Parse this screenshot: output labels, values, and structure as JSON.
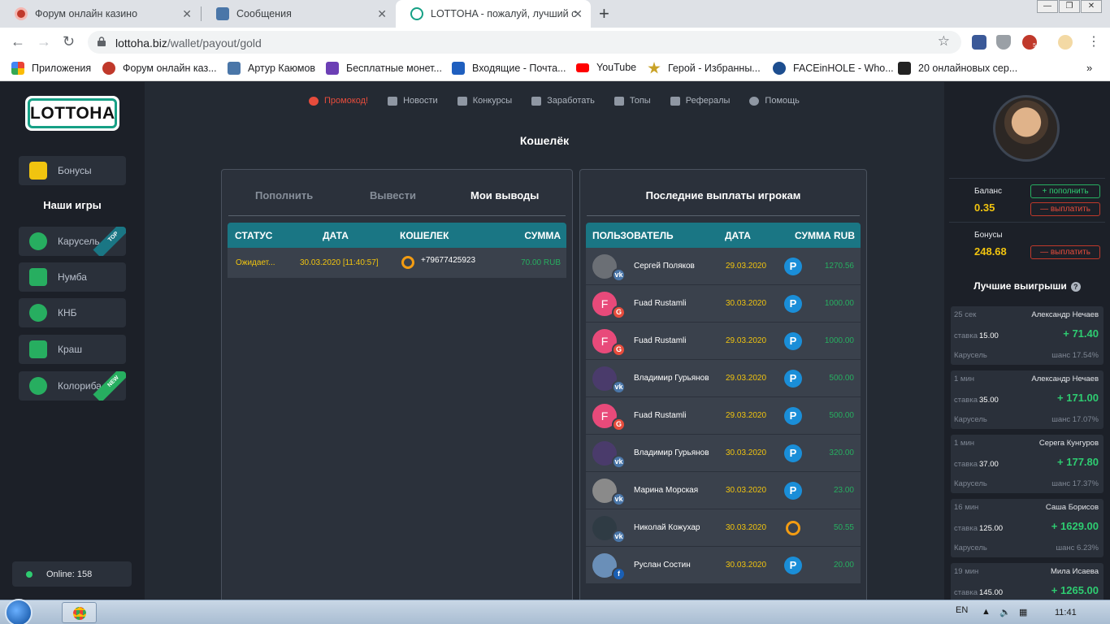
{
  "browser": {
    "tabs": [
      {
        "title": "Форум онлайн казино",
        "active": false
      },
      {
        "title": "Сообщения",
        "active": false
      },
      {
        "title": "LOTTOHA - пожалуй, лучший с",
        "active": true
      }
    ],
    "url_host": "lottoha.biz",
    "url_path": "/wallet/payout/gold",
    "bookmarks": [
      "Приложения",
      "Форум онлайн каз...",
      "Артур Каюмов",
      "Бесплатные монет...",
      "Входящие - Почта...",
      "YouTube",
      "Герой - Избранны...",
      "FACEinHOLE - Who...",
      "20 онлайновых сер..."
    ],
    "ext_badge": "5"
  },
  "site": {
    "logo": "LOTTOHA",
    "bonus_label": "Бонусы",
    "games_header": "Наши игры",
    "games": [
      {
        "label": "Карусель",
        "ribbon": "TOP"
      },
      {
        "label": "Нумба",
        "ribbon": ""
      },
      {
        "label": "КНБ",
        "ribbon": ""
      },
      {
        "label": "Краш",
        "ribbon": ""
      },
      {
        "label": "Колориба",
        "ribbon": "NEW"
      }
    ],
    "online": "Online: 158",
    "nav": [
      "Промокод!",
      "Новости",
      "Конкурсы",
      "Заработать",
      "Топы",
      "Рефералы",
      "Помощь"
    ],
    "page_title": "Кошелёк",
    "wallet": {
      "tabs": [
        "Пополнить",
        "Вывести",
        "Мои выводы"
      ],
      "columns": [
        "СТАТУС",
        "ДАТА",
        "КОШЕЛЕК",
        "СУММА"
      ],
      "rows": [
        {
          "status": "Ожидает...",
          "date": "30.03.2020 [11:40:57]",
          "wallet": "+79677425923",
          "sum": "70.00 RUB"
        }
      ]
    },
    "payouts": {
      "title": "Последние выплаты игрокам",
      "columns": [
        "ПОЛЬЗОВАТЕЛЬ",
        "ДАТА",
        "СУММА RUB"
      ],
      "rows": [
        {
          "name": "Сергей Поляков",
          "date": "29.03.2020",
          "method": "P",
          "sum": "1270.56",
          "social": "vk",
          "avatar": "#6b6f75"
        },
        {
          "name": "Fuad Rustamli",
          "date": "30.03.2020",
          "method": "P",
          "sum": "1000.00",
          "social": "g",
          "avatar": "#e84a7a"
        },
        {
          "name": "Fuad Rustamli",
          "date": "29.03.2020",
          "method": "P",
          "sum": "1000.00",
          "social": "g",
          "avatar": "#e84a7a"
        },
        {
          "name": "Владимир Гурьянов",
          "date": "29.03.2020",
          "method": "P",
          "sum": "500.00",
          "social": "vk",
          "avatar": "#4a3b6b"
        },
        {
          "name": "Fuad Rustamli",
          "date": "29.03.2020",
          "method": "P",
          "sum": "500.00",
          "social": "g",
          "avatar": "#e84a7a"
        },
        {
          "name": "Владимир Гурьянов",
          "date": "30.03.2020",
          "method": "P",
          "sum": "320.00",
          "social": "vk",
          "avatar": "#4a3b6b"
        },
        {
          "name": "Марина Морская",
          "date": "30.03.2020",
          "method": "P",
          "sum": "23.00",
          "social": "vk",
          "avatar": "#8a8a8a"
        },
        {
          "name": "Николай Кожухар",
          "date": "30.03.2020",
          "method": "Q",
          "sum": "50.55",
          "social": "vk",
          "avatar": "#2f3b44"
        },
        {
          "name": "Руслан Состин",
          "date": "30.03.2020",
          "method": "P",
          "sum": "20.00",
          "social": "fb",
          "avatar": "#6a8fb8"
        }
      ]
    },
    "user": {
      "balance_label": "Баланс",
      "balance": "0.35",
      "bonus_label": "Бонусы",
      "bonus": "248.68",
      "deposit_btn": "+ пополнить",
      "withdraw_btn": "— выплатить"
    },
    "wins_title": "Лучшие выигрыши",
    "wins": [
      {
        "time": "25 сек",
        "name": "Александр Нечаев",
        "bet_label": "ставка",
        "bet": "15.00",
        "win": "+ 71.40",
        "game": "Карусель",
        "chance": "шанс 17.54%"
      },
      {
        "time": "1 мин",
        "name": "Александр Нечаев",
        "bet_label": "ставка",
        "bet": "35.00",
        "win": "+ 171.00",
        "game": "Карусель",
        "chance": "шанс 17.07%"
      },
      {
        "time": "1 мин",
        "name": "Серега Кунгуров",
        "bet_label": "ставка",
        "bet": "37.00",
        "win": "+ 177.80",
        "game": "Карусель",
        "chance": "шанс 17.37%"
      },
      {
        "time": "16 мин",
        "name": "Саша Борисов",
        "bet_label": "ставка",
        "bet": "125.00",
        "win": "+ 1629.00",
        "game": "Карусель",
        "chance": "шанс 6.23%"
      },
      {
        "time": "19 мин",
        "name": "Мила Исаева",
        "bet_label": "ставка",
        "bet": "145.00",
        "win": "+ 1265.00",
        "game": "",
        "chance": ""
      }
    ]
  },
  "taskbar": {
    "lang": "EN",
    "clock": "11:41"
  },
  "colors": {
    "accent": "#1a7684",
    "gold": "#f1c40f",
    "green": "#2ecc71",
    "red": "#e74c3c"
  }
}
